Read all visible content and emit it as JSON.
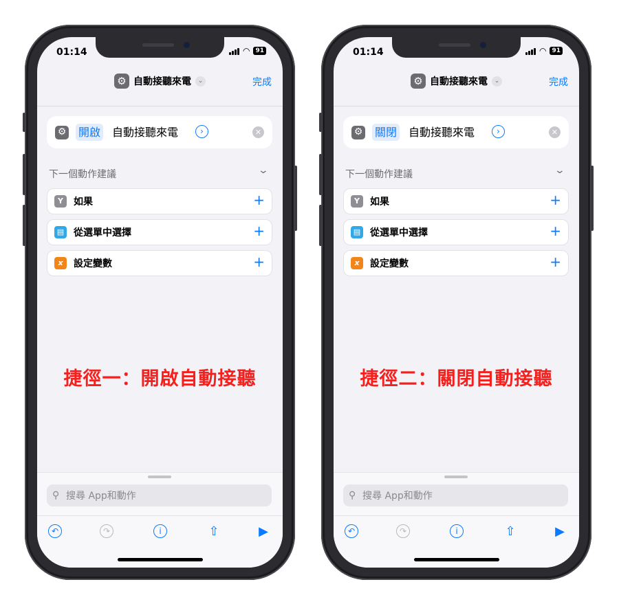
{
  "phones": [
    {
      "status": {
        "time": "01:14",
        "battery": "91"
      },
      "nav": {
        "title": "自動接聽來電",
        "done": "完成"
      },
      "action": {
        "toggle": "開啟",
        "text": "自動接聽來電"
      },
      "suggestions": {
        "header": "下一個動作建議",
        "items": [
          {
            "label": "如果",
            "icon": "branch-icon",
            "color": "#8e8e93"
          },
          {
            "label": "從選單中選擇",
            "icon": "menu-icon",
            "color": "#31a8e8"
          },
          {
            "label": "設定變數",
            "icon": "variable-icon",
            "color": "#f2851a"
          }
        ]
      },
      "caption": "捷徑一：開啟自動接聽",
      "search": {
        "placeholder": "搜尋 App和動作"
      }
    },
    {
      "status": {
        "time": "01:14",
        "battery": "91"
      },
      "nav": {
        "title": "自動接聽來電",
        "done": "完成"
      },
      "action": {
        "toggle": "關閉",
        "text": "自動接聽來電"
      },
      "suggestions": {
        "header": "下一個動作建議",
        "items": [
          {
            "label": "如果",
            "icon": "branch-icon",
            "color": "#8e8e93"
          },
          {
            "label": "從選單中選擇",
            "icon": "menu-icon",
            "color": "#31a8e8"
          },
          {
            "label": "設定變數",
            "icon": "variable-icon",
            "color": "#f2851a"
          }
        ]
      },
      "caption": "捷徑二：關閉自動接聽",
      "search": {
        "placeholder": "搜尋 App和動作"
      }
    }
  ],
  "colors": {
    "accent": "#0a7aff",
    "caption": "#f4201d",
    "background": "#f2f2f7"
  }
}
